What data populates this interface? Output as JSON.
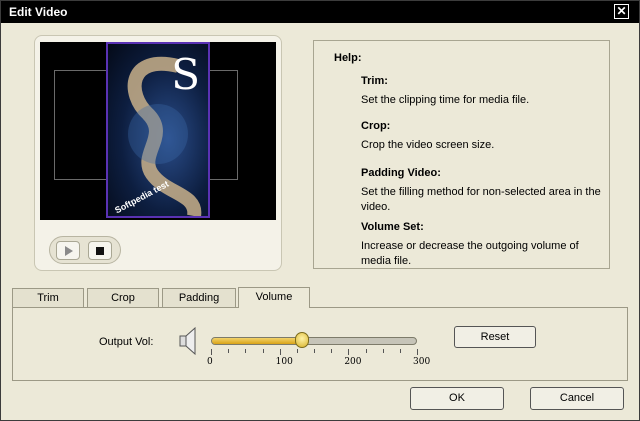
{
  "window": {
    "title": "Edit Video",
    "close_label": "✕"
  },
  "preview": {
    "poster_letter": "S",
    "poster_stamp": "Softpedia test"
  },
  "help": {
    "title": "Help:",
    "sections": [
      {
        "head": "Trim:",
        "body": "Set the clipping time for media file."
      },
      {
        "head": "Crop:",
        "body": "Crop the video screen size."
      },
      {
        "head": "Padding Video:",
        "body": "Set the filling method for non-selected area in the video."
      },
      {
        "head": "Volume Set:",
        "body": "Increase or decrease the outgoing volume of media file."
      }
    ]
  },
  "tabs": [
    {
      "label": "Trim"
    },
    {
      "label": "Crop"
    },
    {
      "label": "Padding"
    },
    {
      "label": "Volume"
    }
  ],
  "active_tab": "Volume",
  "volume": {
    "label": "Output Vol:",
    "value": 132,
    "min": 0,
    "max": 300,
    "tick_labels": [
      "0",
      "100",
      "200",
      "300"
    ],
    "reset_label": "Reset"
  },
  "footer": {
    "ok_label": "OK",
    "cancel_label": "Cancel"
  },
  "colors": {
    "titlebar": "#000000",
    "dialog_bg": "#ece9d8",
    "slider_fill": "#e8b830",
    "poster_border": "#5a32b4"
  },
  "icons": [
    "close-icon",
    "play-icon",
    "stop-icon",
    "speaker-icon",
    "slider-thumb"
  ]
}
